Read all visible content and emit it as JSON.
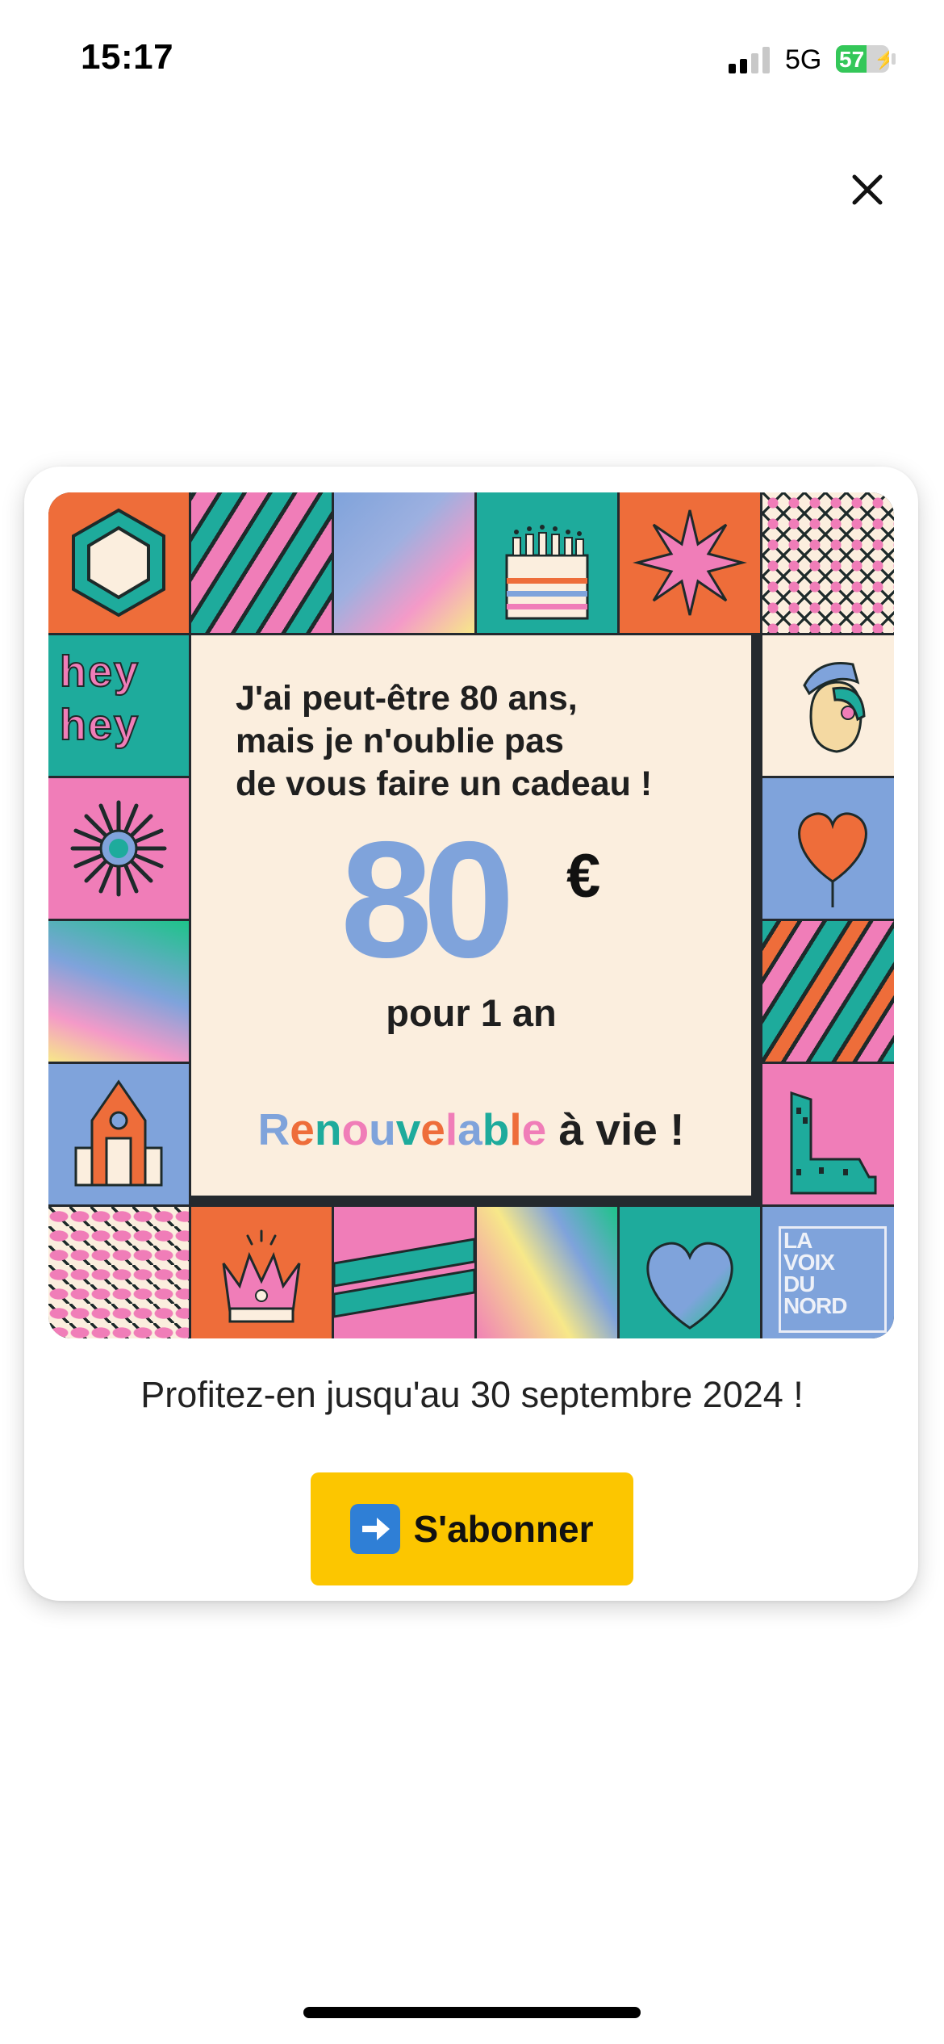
{
  "status_bar": {
    "time": "15:17",
    "network": "5G",
    "battery_percent": "57",
    "battery_level": 0.57,
    "signal_bars_active": 2,
    "signal_bars_total": 4
  },
  "promo": {
    "text_line1": "J'ai peut-être 80 ans,",
    "text_line2": "mais je n'oublie pas",
    "text_line3": "de vous faire un cadeau !",
    "price_value": "80",
    "currency": "€",
    "duration": "pour 1 an",
    "renew_parts": [
      "R",
      "e",
      "n",
      "o",
      "u",
      "v",
      "e",
      "l",
      "a",
      "b",
      "l",
      "e"
    ],
    "renew_suffix": " à vie !",
    "hey_line1": "hey",
    "hey_line2": "hey",
    "logo_line1": "LA",
    "logo_line2": "VOIX",
    "logo_line3": "DU",
    "logo_line4": "NORD"
  },
  "offer": {
    "note": "Profitez-en jusqu'au 30 septembre 2024 !"
  },
  "subscribe": {
    "label": "S'abonner",
    "icon": "right-arrow-icon"
  },
  "colors": {
    "button": "#fcc600",
    "orange": "#ee6d3a",
    "pink": "#f07db8",
    "teal": "#1eab9c",
    "blue": "#7fa3db",
    "cream": "#fbeede"
  }
}
